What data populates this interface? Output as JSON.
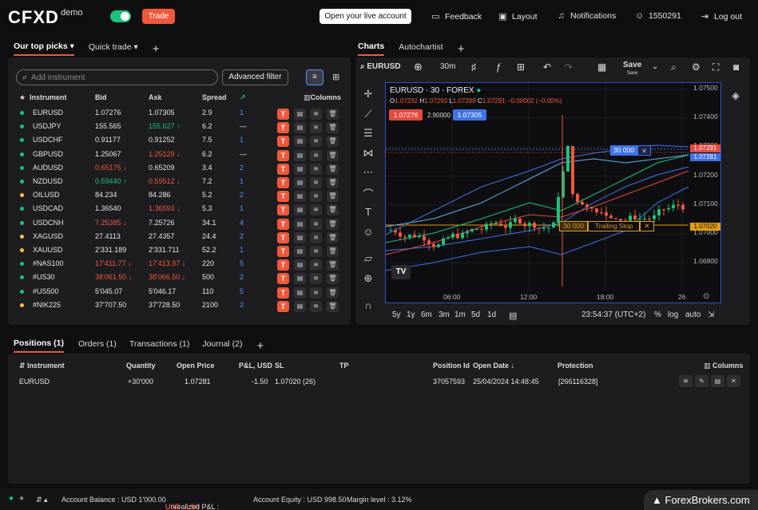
{
  "header": {
    "logo": "CFXD",
    "demo": "demo",
    "trade": "Trade",
    "live": "Open your live account",
    "feedback": "Feedback",
    "layout": "Layout",
    "notifications": "Notifications",
    "account": "1550291",
    "logout": "Log out"
  },
  "left_tabs": [
    "Our top picks",
    "Quick trade"
  ],
  "search": {
    "placeholder": "Add instrument"
  },
  "advanced_filter": "Advanced filter",
  "wl_cols": {
    "instrument": "Instrument",
    "bid": "Bid",
    "ask": "Ask",
    "spread": "Spread",
    "columns": "Columns"
  },
  "watchlist": [
    {
      "name": "EURUSD",
      "bid": "1.07276",
      "ask": "1.07305",
      "spread": "2.9",
      "n": "1",
      "dot": "#19c37d",
      "bc": "",
      "ac": ""
    },
    {
      "name": "USDJPY",
      "bid": "155.565",
      "ask": "155.627 ↑",
      "spread": "6.2",
      "n": "—",
      "dot": "#19c37d",
      "bc": "",
      "ac": "up"
    },
    {
      "name": "USDCHF",
      "bid": "0.91177",
      "ask": "0.91252",
      "spread": "7.5",
      "n": "1",
      "dot": "#19c37d",
      "bc": "",
      "ac": ""
    },
    {
      "name": "GBPUSD",
      "bid": "1.25067",
      "ask": "1.25129 ↓",
      "spread": "6.2",
      "n": "—",
      "dot": "#19c37d",
      "bc": "",
      "ac": "dn"
    },
    {
      "name": "AUDUSD",
      "bid": "0.65175 ↓",
      "ask": "0.65209",
      "spread": "3.4",
      "n": "2",
      "dot": "#19c37d",
      "bc": "dn",
      "ac": ""
    },
    {
      "name": "NZDUSD",
      "bid": "0.59440 ↑",
      "ask": "0.59512 ↓",
      "spread": "7.2",
      "n": "1",
      "dot": "#19c37d",
      "bc": "up",
      "ac": "dn"
    },
    {
      "name": "OILUSD",
      "bid": "84.234",
      "ask": "84.286",
      "spread": "5.2",
      "n": "2",
      "dot": "#f5c242",
      "bc": "",
      "ac": ""
    },
    {
      "name": "USDCAD",
      "bid": "1.36540",
      "ask": "1.36593 ↓",
      "spread": "5.3",
      "n": "1",
      "dot": "#19c37d",
      "bc": "",
      "ac": "dn"
    },
    {
      "name": "USDCNH",
      "bid": "7.25385 ↓",
      "ask": "7.25726",
      "spread": "34.1",
      "n": "4",
      "dot": "#19c37d",
      "bc": "dn",
      "ac": ""
    },
    {
      "name": "XAGUSD",
      "bid": "27.4113",
      "ask": "27.4357",
      "spread": "24.4",
      "n": "2",
      "dot": "#f5c242",
      "bc": "",
      "ac": ""
    },
    {
      "name": "XAUUSD",
      "bid": "2'331.189",
      "ask": "2'331.711",
      "spread": "52.2",
      "n": "1",
      "dot": "#f5c242",
      "bc": "",
      "ac": ""
    },
    {
      "name": "#NAS100",
      "bid": "17'411.77 ↓",
      "ask": "17'413.97 ↓",
      "spread": "220",
      "n": "5",
      "dot": "#19c37d",
      "bc": "dn",
      "ac": "dn"
    },
    {
      "name": "#US30",
      "bid": "38'061.50 ↓",
      "ask": "38'066.50 ↓",
      "spread": "500",
      "n": "2",
      "dot": "#19c37d",
      "bc": "dn",
      "ac": "dn"
    },
    {
      "name": "#US500",
      "bid": "5'045.07",
      "ask": "5'046.17",
      "spread": "110",
      "n": "5",
      "dot": "#19c37d",
      "bc": "",
      "ac": ""
    },
    {
      "name": "#NIK225",
      "bid": "37'707.50",
      "ask": "37'728.50",
      "spread": "2100",
      "n": "2",
      "dot": "#f5c242",
      "bc": "",
      "ac": ""
    }
  ],
  "chart_tabs": [
    "Charts",
    "Autochartist"
  ],
  "chart_toolbar": {
    "symbol": "EURUSD",
    "interval": "30m",
    "save": "Save",
    "save_sub": "Save"
  },
  "chart": {
    "title": "EURUSD · 30 · FOREX",
    "o": "1.07292",
    "h": "1.07293",
    "l": "1.07288",
    "c": "1.07291",
    "chg": "−0.00002 (−0.00%)",
    "sell": "1.07276",
    "spread": "2.90000",
    "buy": "1.07305",
    "y_ticks": [
      "1.07500",
      "1.07400",
      "1.07300",
      "1.07200",
      "1.07100",
      "1.07000",
      "1.06900"
    ],
    "x_ticks": [
      "06:00",
      "12:00",
      "18:00",
      "26"
    ],
    "price_tag": "1.07291",
    "ask_tag": "1.07281",
    "sl_tag": "1.07020",
    "pos_label": "30 000",
    "sl_label": "30 000",
    "trailing": "Trailing Stop",
    "ranges": [
      "5y",
      "1y",
      "6m",
      "3m",
      "1m",
      "5d",
      "1d"
    ],
    "time": "23:54:37 (UTC+2)",
    "pct": "%",
    "log": "log",
    "auto": "auto",
    "colors": {
      "up": "#19c37d",
      "down": "#f0583a",
      "accent": "#2d4fc2"
    }
  },
  "bottom_tabs": [
    "Positions (1)",
    "Orders (1)",
    "Transactions (1)",
    "Journal (2)"
  ],
  "pos_cols": {
    "instrument": "Instrument",
    "quantity": "Quantity",
    "open_price": "Open Price",
    "pnl": "P&L, USD",
    "sl": "SL",
    "tp": "TP",
    "position_id": "Position Id",
    "open_date": "Open Date ↓",
    "protection": "Protection",
    "columns": "Columns"
  },
  "position": {
    "instrument": "EURUSD",
    "quantity": "+30'000",
    "open_price": "1.07281",
    "pnl": "-1.50",
    "sl": "1.07020 (26)",
    "tp": "",
    "position_id": "37057593",
    "open_date": "25/04/2024 14:48:45",
    "protection": "[266116328]"
  },
  "status": {
    "balance": "Account Balance : USD 1'000.00",
    "unrealized": "Unrealized P&L : ",
    "unrealized_val": "USD -1.50",
    "equity": "Account Equity : USD 998.50",
    "margin": "Margin level : 3.12%"
  },
  "watermark": "ForexBrokers.com"
}
